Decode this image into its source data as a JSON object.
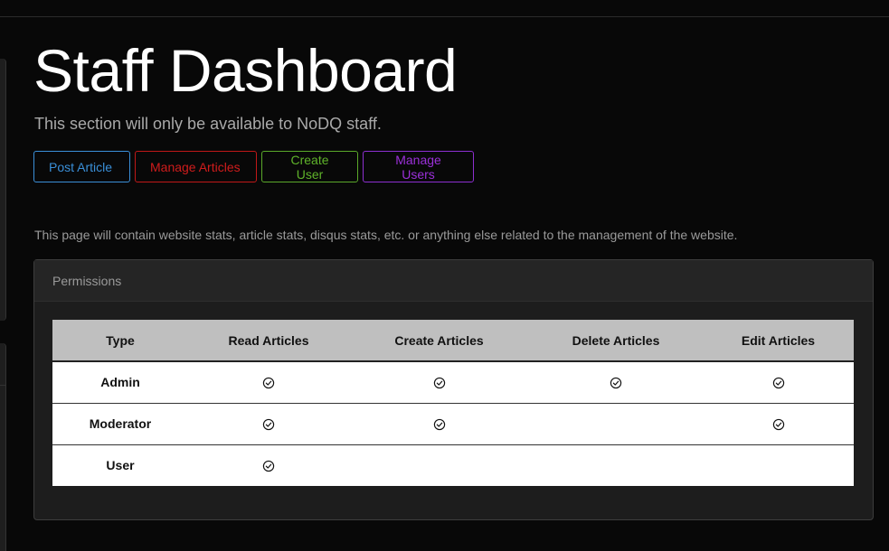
{
  "header": {
    "title": "Staff Dashboard",
    "subtitle": "This section will only be available to NoDQ staff."
  },
  "actions": {
    "post_article": "Post Article",
    "manage_articles": "Manage Articles",
    "create_user": "Create User",
    "manage_users": "Manage Users"
  },
  "note": "This page will contain website stats, article stats, disqus stats, etc. or anything else related to the management of the website.",
  "permissions": {
    "title": "Permissions",
    "columns": [
      "Type",
      "Read Articles",
      "Create Articles",
      "Delete Articles",
      "Edit Articles"
    ],
    "rows": [
      {
        "type": "Admin",
        "read": true,
        "create": true,
        "delete": true,
        "edit": true
      },
      {
        "type": "Moderator",
        "read": true,
        "create": true,
        "delete": false,
        "edit": true
      },
      {
        "type": "User",
        "read": true,
        "create": false,
        "delete": false,
        "edit": false
      }
    ]
  },
  "icons": {
    "check": "check-circle-icon"
  },
  "colors": {
    "post_article": "#3a8fd8",
    "manage_articles": "#d01c1c",
    "create_user": "#5fb32a",
    "manage_users": "#9b30d9"
  }
}
